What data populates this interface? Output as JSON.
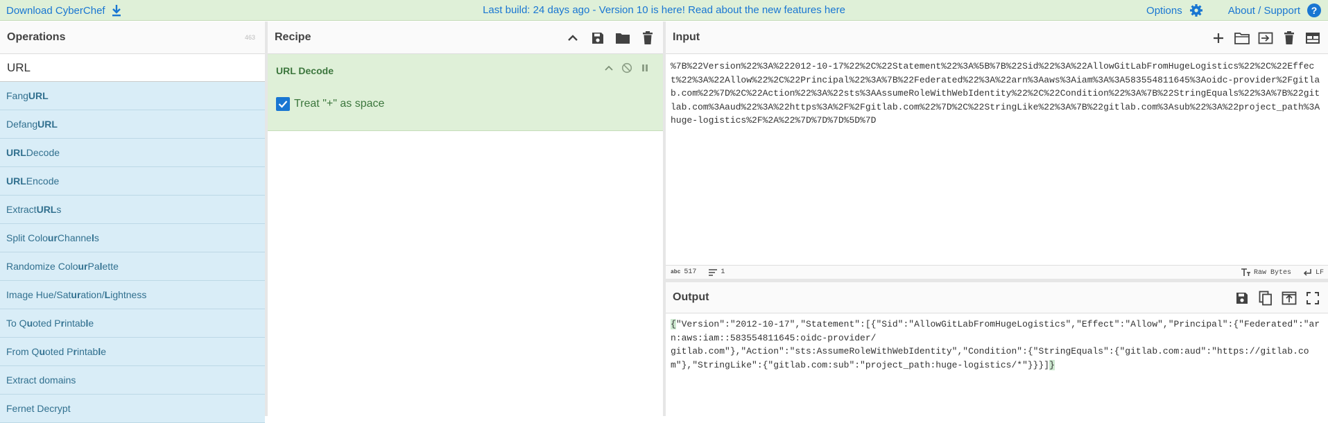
{
  "banner": {
    "download_label": "Download CyberChef",
    "build_text": "Last build: 24 days ago - Version 10 is here! Read about the new features here",
    "options_label": "Options",
    "about_label": "About / Support",
    "help_glyph": "?"
  },
  "operations": {
    "title": "Operations",
    "count": "463",
    "search_value": "URL",
    "items": [
      {
        "parts": [
          {
            "t": "Fang ",
            "b": false
          },
          {
            "t": "URL",
            "b": true
          }
        ]
      },
      {
        "parts": [
          {
            "t": "Defang ",
            "b": false
          },
          {
            "t": "URL",
            "b": true
          }
        ]
      },
      {
        "parts": [
          {
            "t": "URL",
            "b": true
          },
          {
            "t": " Decode",
            "b": false
          }
        ]
      },
      {
        "parts": [
          {
            "t": "URL",
            "b": true
          },
          {
            "t": " Encode",
            "b": false
          }
        ]
      },
      {
        "parts": [
          {
            "t": "Extract ",
            "b": false
          },
          {
            "t": "URL",
            "b": true
          },
          {
            "t": "s",
            "b": false
          }
        ]
      },
      {
        "parts": [
          {
            "t": "Split Colo",
            "b": false
          },
          {
            "t": "ur",
            "b": true
          },
          {
            "t": " Channe",
            "b": false
          },
          {
            "t": "l",
            "b": true
          },
          {
            "t": "s",
            "b": false
          }
        ]
      },
      {
        "parts": [
          {
            "t": "Randomize Colo",
            "b": false
          },
          {
            "t": "ur",
            "b": true
          },
          {
            "t": " Pa",
            "b": false
          },
          {
            "t": "l",
            "b": true
          },
          {
            "t": "ette",
            "b": false
          }
        ]
      },
      {
        "parts": [
          {
            "t": "Image Hue/Sat",
            "b": false
          },
          {
            "t": "ur",
            "b": true
          },
          {
            "t": "ation/",
            "b": false
          },
          {
            "t": "L",
            "b": true
          },
          {
            "t": "ightness",
            "b": false
          }
        ]
      },
      {
        "parts": [
          {
            "t": "To Q",
            "b": false
          },
          {
            "t": "u",
            "b": true
          },
          {
            "t": "oted P",
            "b": false
          },
          {
            "t": "r",
            "b": true
          },
          {
            "t": "intab",
            "b": false
          },
          {
            "t": "l",
            "b": true
          },
          {
            "t": "e",
            "b": false
          }
        ]
      },
      {
        "parts": [
          {
            "t": "From Q",
            "b": false
          },
          {
            "t": "u",
            "b": true
          },
          {
            "t": "oted P",
            "b": false
          },
          {
            "t": "r",
            "b": true
          },
          {
            "t": "intab",
            "b": false
          },
          {
            "t": "l",
            "b": true
          },
          {
            "t": "e",
            "b": false
          }
        ]
      },
      {
        "parts": [
          {
            "t": "Extract domains",
            "b": false
          }
        ]
      },
      {
        "parts": [
          {
            "t": "Fernet Decrypt",
            "b": false
          }
        ]
      }
    ]
  },
  "recipe": {
    "title": "Recipe",
    "operation_name": "URL Decode",
    "option_label": "Treat \"+\" as space",
    "option_checked": true
  },
  "input": {
    "title": "Input",
    "text": "%7B%22Version%22%3A%222012-10-17%22%2C%22Statement%22%3A%5B%7B%22Sid%22%3A%22AllowGitLabFromHugeLogistics%22%2C%22Effect%22%3A%22Allow%22%2C%22Principal%22%3A%7B%22Federated%22%3A%22arn%3Aaws%3Aiam%3A%3A583554811645%3Aoidc-provider%2Fgitlab.com%22%7D%2C%22Action%22%3A%22sts%3AAssumeRoleWithWebIdentity%22%2C%22Condition%22%3A%7B%22StringEquals%22%3A%7B%22gitlab.com%3Aaud%22%3A%22https%3A%2F%2Fgitlab.com%22%7D%2C%22StringLike%22%3A%7B%22gitlab.com%3Asub%22%3A%22project_path%3Ahuge-logistics%2F%2A%22%7D%7D%7D%5D%7D",
    "char_label": "abc",
    "char_count": "517",
    "line_count": "1",
    "encoding": "Raw Bytes",
    "eol": "LF"
  },
  "output": {
    "title": "Output",
    "open_brace": "{",
    "body": "\"Version\":\"2012-10-17\",\"Statement\":[{\"Sid\":\"AllowGitLabFromHugeLogistics\",\"Effect\":\"Allow\",\"Principal\":{\"Federated\":\"arn:aws:iam::583554811645:oidc-provider/\ngitlab.com\"},\"Action\":\"sts:AssumeRoleWithWebIdentity\",\"Condition\":{\"StringEquals\":{\"gitlab.com:aud\":\"https://gitlab.com\"},\"StringLike\":{\"gitlab.com:sub\":\"project_path:huge-logistics/*\"}}}]",
    "close_brace": "}"
  },
  "colors": {
    "accent": "#1976d2",
    "banner_bg": "#dff0d8",
    "op_list_bg": "#d9edf7",
    "recipe_op_bg": "#dff0d8"
  }
}
